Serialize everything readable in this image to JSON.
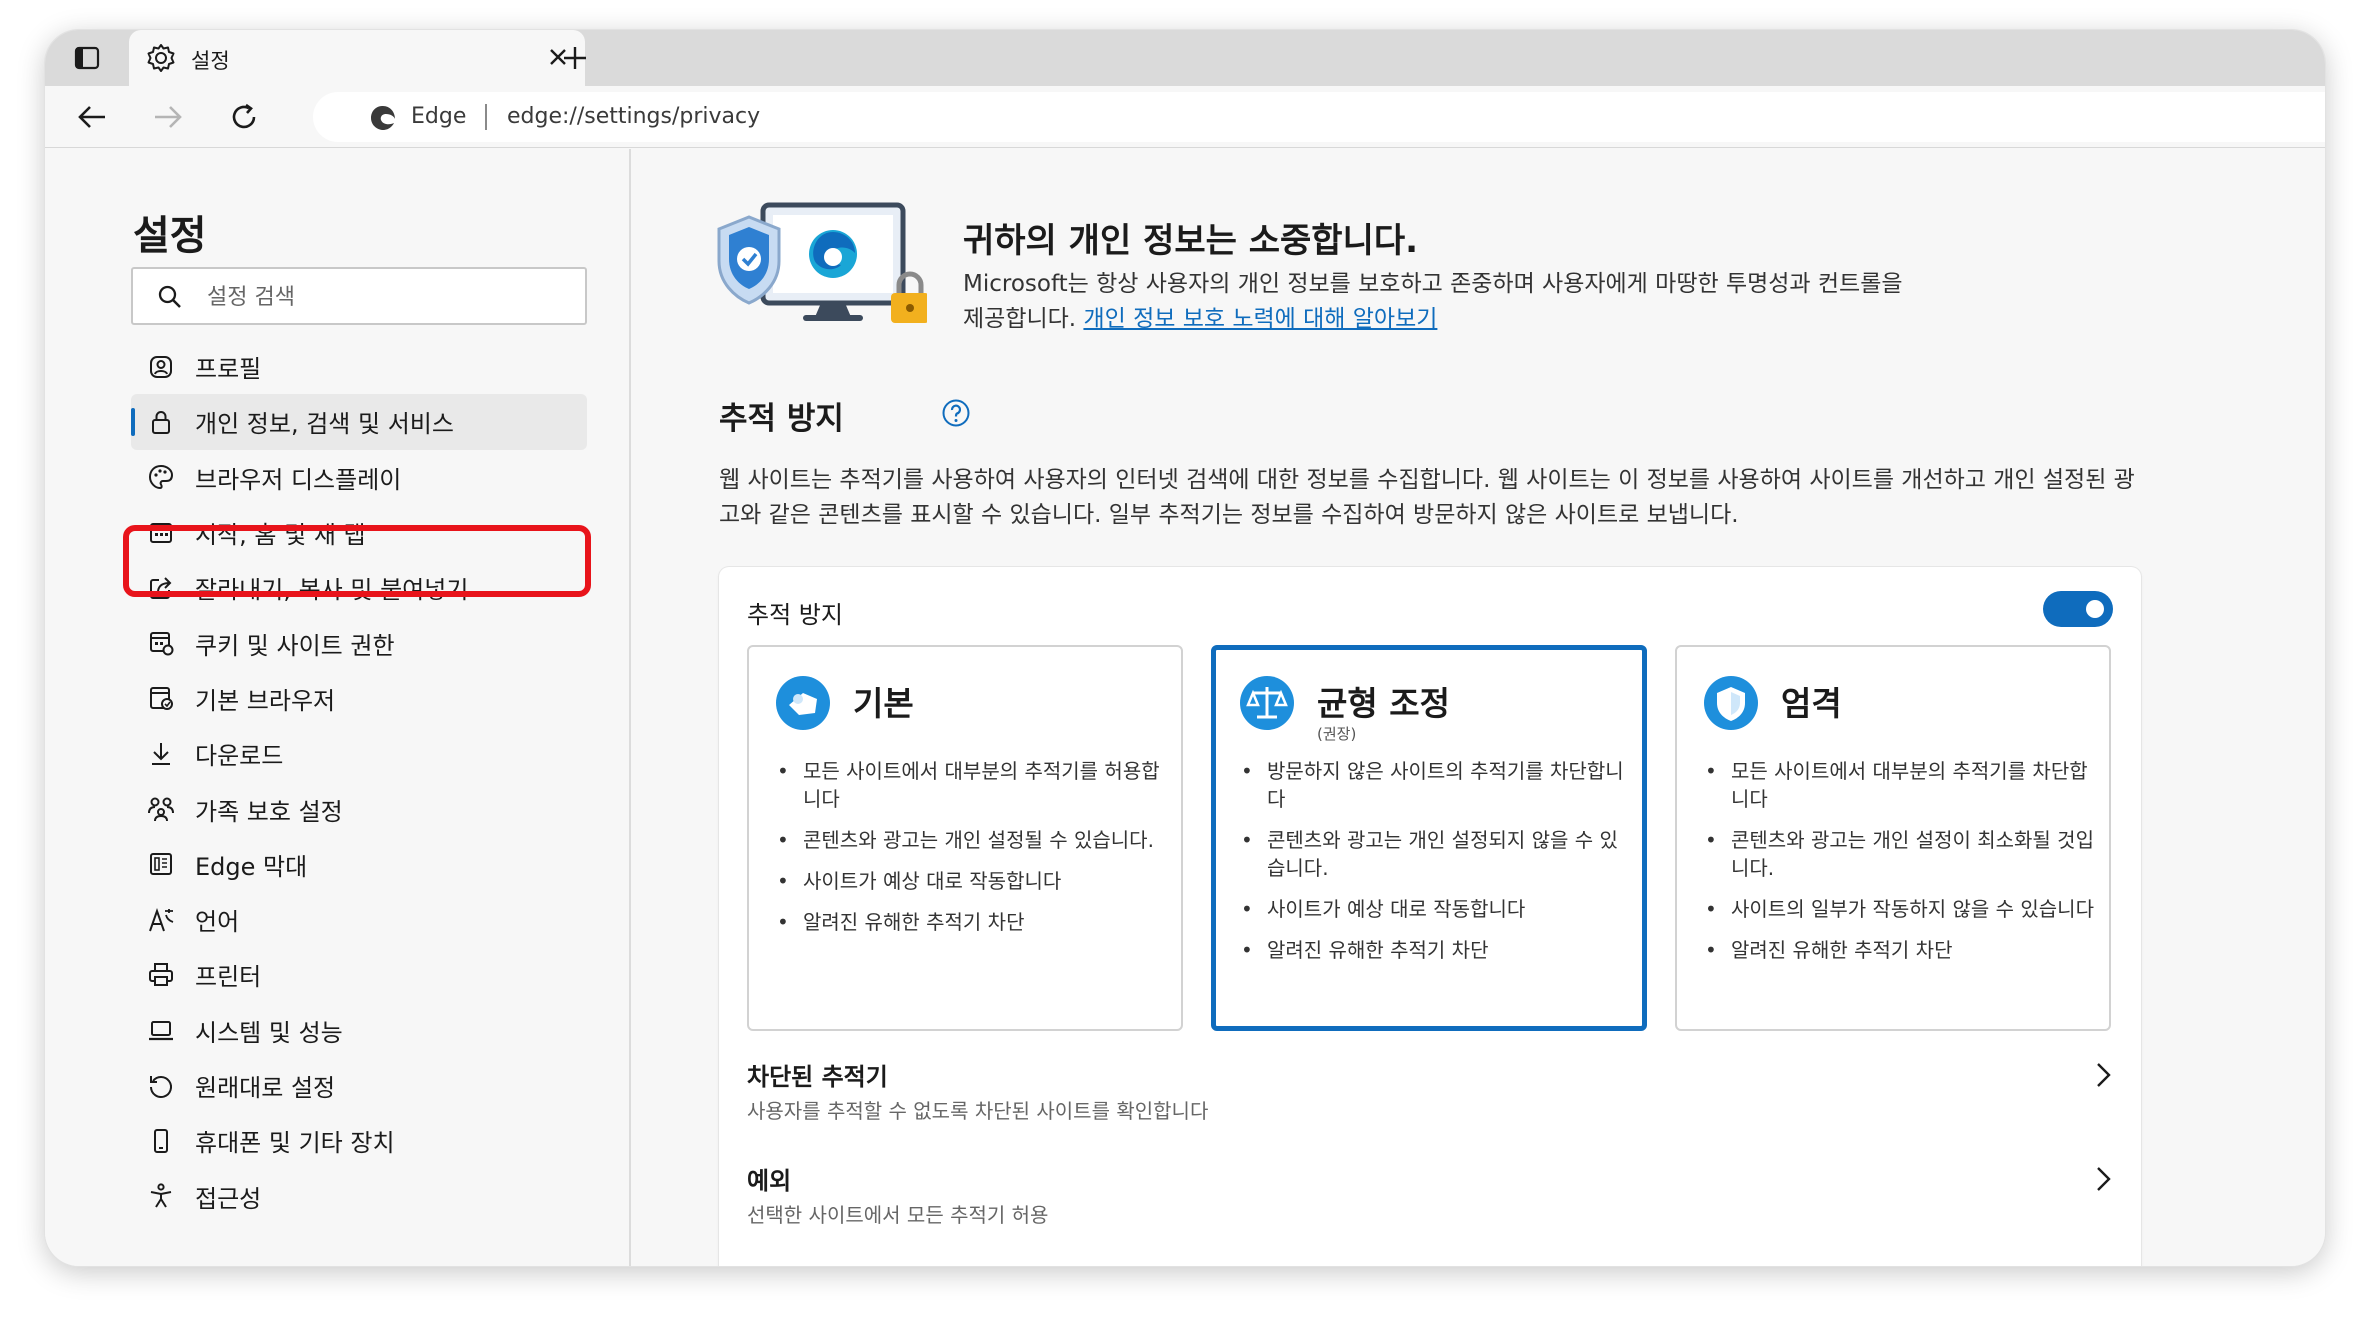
{
  "browser": {
    "tab_title": "설정",
    "app_name": "Edge",
    "url": "edge://settings/privacy"
  },
  "sidebar": {
    "title": "설정",
    "search_placeholder": "설정 검색",
    "items": [
      {
        "label": "프로필",
        "icon": "profile-icon"
      },
      {
        "label": "개인 정보, 검색 및 서비스",
        "icon": "lock-icon",
        "active": true
      },
      {
        "label": "브라우저 디스플레이",
        "icon": "palette-icon"
      },
      {
        "label": "시작, 홈 및 새 탭",
        "icon": "home-grid-icon"
      },
      {
        "label": "잘라내기, 복사 및 붙여넣기",
        "icon": "share-icon"
      },
      {
        "label": "쿠키 및 사이트 권한",
        "icon": "cookie-icon"
      },
      {
        "label": "기본 브라우저",
        "icon": "browser-icon"
      },
      {
        "label": "다운로드",
        "icon": "download-icon"
      },
      {
        "label": "가족 보호 설정",
        "icon": "family-icon"
      },
      {
        "label": "Edge 막대",
        "icon": "bar-icon"
      },
      {
        "label": "언어",
        "icon": "language-icon"
      },
      {
        "label": "프린터",
        "icon": "printer-icon"
      },
      {
        "label": "시스템 및 성능",
        "icon": "laptop-icon"
      },
      {
        "label": "원래대로 설정",
        "icon": "reset-icon"
      },
      {
        "label": "휴대폰 및 기타 장치",
        "icon": "phone-icon"
      },
      {
        "label": "접근성",
        "icon": "accessibility-icon"
      }
    ]
  },
  "hero": {
    "title": "귀하의 개인 정보는 소중합니다.",
    "text": "Microsoft는 항상 사용자의 개인 정보를 보호하고 존중하며 사용자에게 마땅한 투명성과 컨트롤을 제공합니다.",
    "link": "개인 정보 보호 노력에 대해 알아보기"
  },
  "tracking": {
    "section_title": "추적 방지",
    "description": "웹 사이트는 추적기를 사용하여 사용자의 인터넷 검색에 대한 정보를 수집합니다. 웹 사이트는 이 정보를 사용하여 사이트를 개선하고 개인 설정된 광고와 같은 콘텐츠를 표시할 수 있습니다. 일부 추적기는 정보를 수집하여 방문하지 않은 사이트로 보냅니다.",
    "card_title": "추적 방지",
    "toggle_on": true,
    "options": [
      {
        "title": "기본",
        "subtitle": "",
        "icon": "basic-tracker-icon",
        "bullets": [
          "모든 사이트에서 대부분의 추적기를 허용합니다",
          "콘텐츠와 광고는 개인 설정될 수 있습니다.",
          "사이트가 예상 대로 작동합니다",
          "알려진 유해한 추적기 차단"
        ]
      },
      {
        "title": "균형 조정",
        "subtitle": "(권장)",
        "icon": "balance-scale-icon",
        "selected": true,
        "bullets": [
          "방문하지 않은 사이트의 추적기를 차단합니다",
          "콘텐츠와 광고는 개인 설정되지 않을 수 있습니다.",
          "사이트가 예상 대로 작동합니다",
          "알려진 유해한 추적기 차단"
        ]
      },
      {
        "title": "엄격",
        "subtitle": "",
        "icon": "shield-icon",
        "bullets": [
          "모든 사이트에서 대부분의 추적기를 차단합니다",
          "콘텐츠와 광고는 개인 설정이 최소화될 것입니다.",
          "사이트의 일부가 작동하지 않을 수 있습니다",
          "알려진 유해한 추적기 차단"
        ]
      }
    ],
    "rows": [
      {
        "title": "차단된 추적기",
        "desc": "사용자를 추적할 수 없도록 차단된 사이트를 확인합니다"
      },
      {
        "title": "예외",
        "desc": "선택한 사이트에서 모든 추적기 허용"
      }
    ]
  },
  "colors": {
    "accent": "#0f6cbd",
    "highlight": "#e8141b"
  }
}
